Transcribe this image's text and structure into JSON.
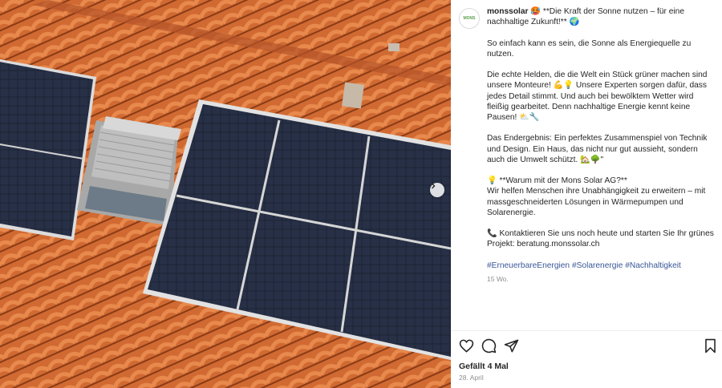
{
  "media": {
    "image_description_name": "solar-panels-on-tiled-roof-photo"
  },
  "account": {
    "avatar_text": "MONS",
    "username": "monssolar"
  },
  "caption": {
    "line1": " 🥵 **Die Kraft der Sonne nutzen – für eine nachhaltige Zukunft!** 🌍",
    "p2": "So einfach kann es sein, die Sonne als Energiequelle zu nutzen.",
    "p3": "Die echte Helden, die die Welt ein Stück grüner machen sind unsere Monteure! 💪💡 Unsere Experten sorgen dafür, dass jedes Detail stimmt. Und auch bei bewölktem Wetter wird fleißig gearbeitet. Denn nachhaltige Energie kennt keine Pausen! ⛅🔧",
    "p4": "Das Endergebnis: Ein perfektes Zusammenspiel von Technik und Design. Ein Haus, das nicht nur gut aussieht, sondern auch die Umwelt schützt. 🏡🌳\"",
    "p5_line1": "💡 **Warum mit der Mons Solar AG?**",
    "p5_line2": "Wir helfen Menschen ihre Unabhängigkeit zu erweitern – mit massgeschneiderten Lösungen in Wärmepumpen und Solarenergie.",
    "p6": "📞 Kontaktieren Sie uns noch heute und starten Sie Ihr grünes Projekt: beratung.monssolar.ch",
    "hashtags": [
      "#ErneuerbareEnergien",
      "#Solarenergie",
      "#Nachhaltigkeit"
    ],
    "time_ago": "15 Wo."
  },
  "engagement": {
    "likes": "Gefällt 4 Mal",
    "date": "28. April"
  },
  "colors": {
    "roof": "#c9622c",
    "panel": "#1d2333",
    "hashtag": "#385898",
    "muted": "#8e8e8e"
  }
}
